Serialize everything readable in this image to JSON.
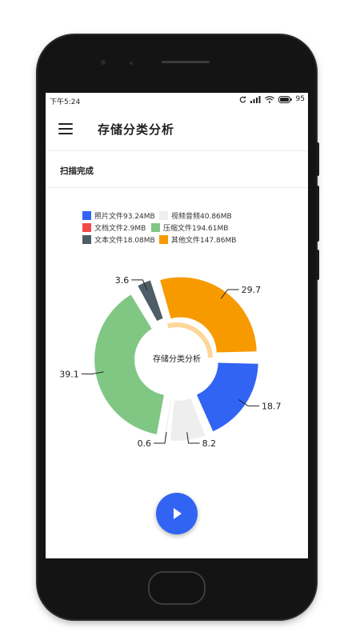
{
  "status": {
    "time": "下午5:24",
    "battery": "95"
  },
  "header": {
    "title": "存储分类分析"
  },
  "scan": {
    "status": "扫描完成"
  },
  "legend": [
    {
      "label": "照片文件93.24MB",
      "color": "#3264f3"
    },
    {
      "label": "视频音频40.86MB",
      "color": "#eeeeee"
    },
    {
      "label": "文档文件2.9MB",
      "color": "#f24a4a"
    },
    {
      "label": "压缩文件194.61MB",
      "color": "#80c784"
    },
    {
      "label": "文本文件18.08MB",
      "color": "#4f5e66"
    },
    {
      "label": "其他文件147.86MB",
      "color": "#f79a00"
    }
  ],
  "chart_data": {
    "type": "pie",
    "title": "",
    "center_label": "存储分类分析",
    "slices": [
      {
        "name": "照片文件",
        "value": 18.7,
        "label": "18.7",
        "color": "#3264f3"
      },
      {
        "name": "视频音频",
        "value": 8.2,
        "label": "8.2",
        "color": "#eeeeee"
      },
      {
        "name": "文档文件",
        "value": 0.6,
        "label": "0.6",
        "color": "#f24a4a"
      },
      {
        "name": "压缩文件",
        "value": 39.1,
        "label": "39.1",
        "color": "#80c784"
      },
      {
        "name": "文本文件",
        "value": 3.6,
        "label": "3.6",
        "color": "#4f5e66"
      },
      {
        "name": "其他文件",
        "value": 29.7,
        "label": "29.7",
        "color": "#f79a00"
      }
    ],
    "selected": "其他文件"
  }
}
